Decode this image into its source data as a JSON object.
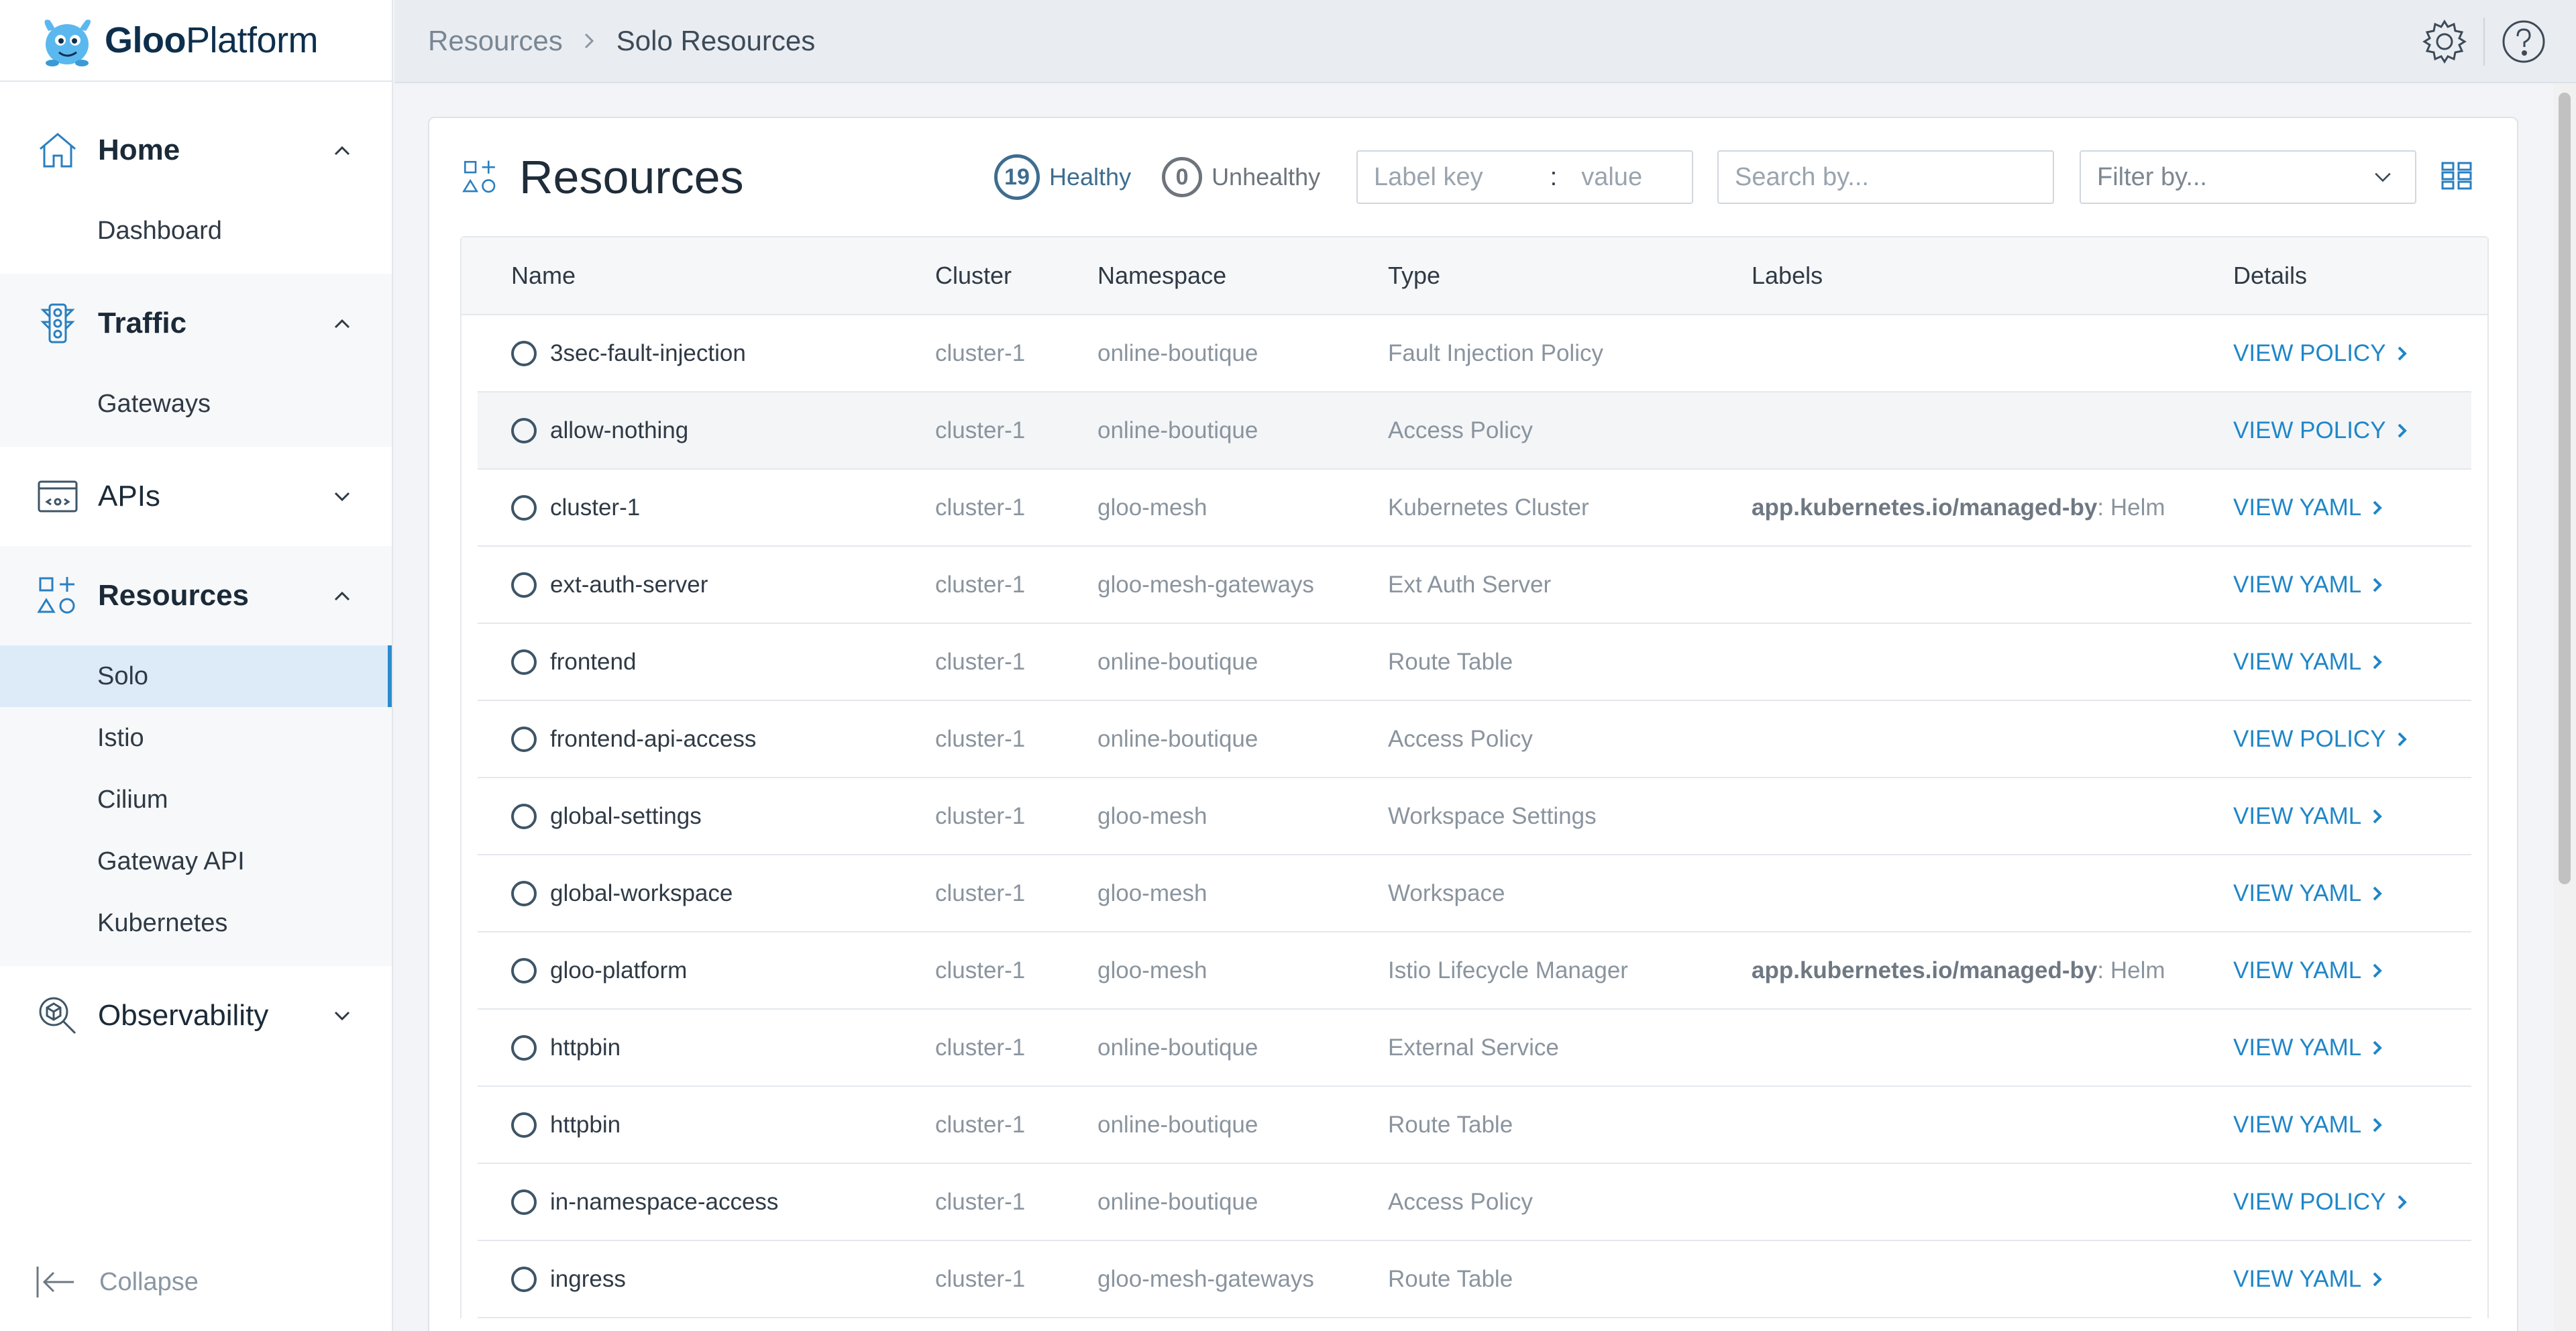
{
  "app": {
    "logo_text_bold": "Gloo",
    "logo_text_light": "Platform"
  },
  "breadcrumb": {
    "items": [
      "Resources",
      "Solo Resources"
    ]
  },
  "sidebar": {
    "groups": [
      {
        "label": "Home",
        "icon": "home-icon",
        "expanded": true,
        "items": [
          "Dashboard"
        ]
      },
      {
        "label": "Traffic",
        "icon": "traffic-light-icon",
        "expanded": true,
        "items": [
          "Gateways"
        ]
      },
      {
        "label": "APIs",
        "icon": "api-icon",
        "expanded": false,
        "items": []
      },
      {
        "label": "Resources",
        "icon": "resources-icon",
        "expanded": true,
        "items": [
          "Solo",
          "Istio",
          "Cilium",
          "Gateway API",
          "Kubernetes"
        ],
        "active_item": "Solo"
      },
      {
        "label": "Observability",
        "icon": "observability-icon",
        "expanded": false,
        "items": []
      }
    ],
    "collapse_label": "Collapse"
  },
  "panel": {
    "title": "Resources",
    "healthy_count": "19",
    "healthy_label": "Healthy",
    "unhealthy_count": "0",
    "unhealthy_label": "Unhealthy",
    "label_key_placeholder": "Label key",
    "label_colon": ":",
    "label_value_placeholder": "value",
    "search_placeholder": "Search by...",
    "filter_placeholder": "Filter by..."
  },
  "table": {
    "columns": [
      "Name",
      "Cluster",
      "Namespace",
      "Type",
      "Labels",
      "Details"
    ],
    "rows": [
      {
        "name": "3sec-fault-injection",
        "cluster": "cluster-1",
        "namespace": "online-boutique",
        "type": "Fault Injection Policy",
        "label_key": "",
        "label_value": "",
        "details": "VIEW POLICY"
      },
      {
        "name": "allow-nothing",
        "cluster": "cluster-1",
        "namespace": "online-boutique",
        "type": "Access Policy",
        "label_key": "",
        "label_value": "",
        "details": "VIEW POLICY"
      },
      {
        "name": "cluster-1",
        "cluster": "cluster-1",
        "namespace": "gloo-mesh",
        "type": "Kubernetes Cluster",
        "label_key": "app.kubernetes.io/managed-by",
        "label_value": ": Helm",
        "details": "VIEW YAML"
      },
      {
        "name": "ext-auth-server",
        "cluster": "cluster-1",
        "namespace": "gloo-mesh-gateways",
        "type": "Ext Auth Server",
        "label_key": "",
        "label_value": "",
        "details": "VIEW YAML"
      },
      {
        "name": "frontend",
        "cluster": "cluster-1",
        "namespace": "online-boutique",
        "type": "Route Table",
        "label_key": "",
        "label_value": "",
        "details": "VIEW YAML"
      },
      {
        "name": "frontend-api-access",
        "cluster": "cluster-1",
        "namespace": "online-boutique",
        "type": "Access Policy",
        "label_key": "",
        "label_value": "",
        "details": "VIEW POLICY"
      },
      {
        "name": "global-settings",
        "cluster": "cluster-1",
        "namespace": "gloo-mesh",
        "type": "Workspace Settings",
        "label_key": "",
        "label_value": "",
        "details": "VIEW YAML"
      },
      {
        "name": "global-workspace",
        "cluster": "cluster-1",
        "namespace": "gloo-mesh",
        "type": "Workspace",
        "label_key": "",
        "label_value": "",
        "details": "VIEW YAML"
      },
      {
        "name": "gloo-platform",
        "cluster": "cluster-1",
        "namespace": "gloo-mesh",
        "type": "Istio Lifecycle Manager",
        "label_key": "app.kubernetes.io/managed-by",
        "label_value": ": Helm",
        "details": "VIEW YAML"
      },
      {
        "name": "httpbin",
        "cluster": "cluster-1",
        "namespace": "online-boutique",
        "type": "External Service",
        "label_key": "",
        "label_value": "",
        "details": "VIEW YAML"
      },
      {
        "name": "httpbin",
        "cluster": "cluster-1",
        "namespace": "online-boutique",
        "type": "Route Table",
        "label_key": "",
        "label_value": "",
        "details": "VIEW YAML"
      },
      {
        "name": "in-namespace-access",
        "cluster": "cluster-1",
        "namespace": "online-boutique",
        "type": "Access Policy",
        "label_key": "",
        "label_value": "",
        "details": "VIEW POLICY"
      },
      {
        "name": "ingress",
        "cluster": "cluster-1",
        "namespace": "gloo-mesh-gateways",
        "type": "Route Table",
        "label_key": "",
        "label_value": "",
        "details": "VIEW YAML"
      }
    ]
  },
  "colors": {
    "accent": "#1f86c8",
    "healthy": "#3d6d8f",
    "active_nav_bg": "#dcebf7"
  }
}
